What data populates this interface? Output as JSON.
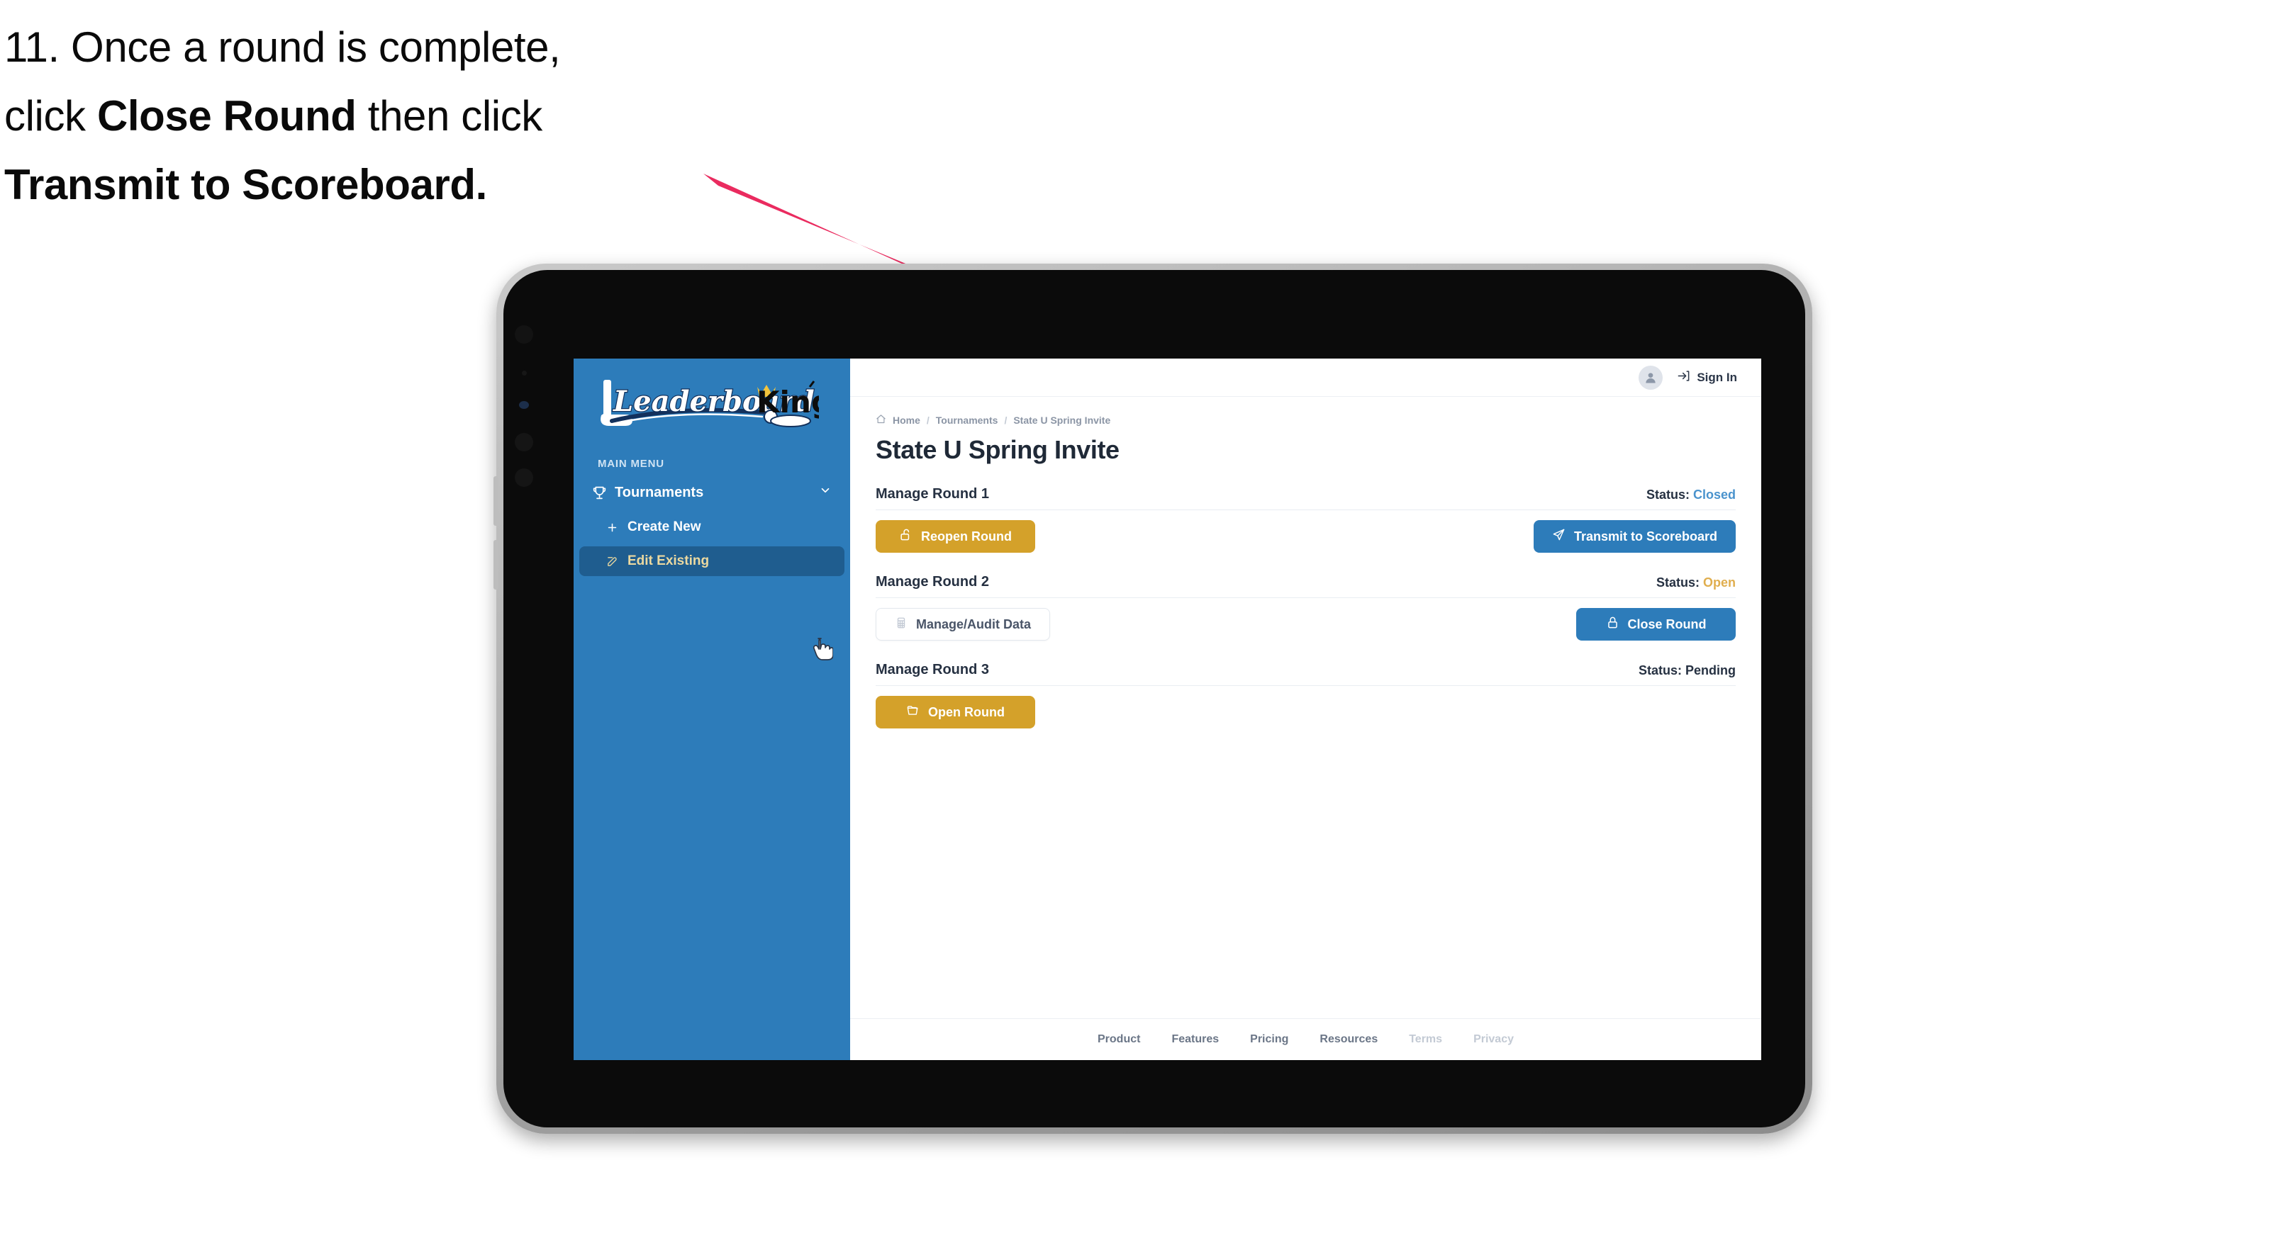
{
  "annotation": {
    "step_number": "11.",
    "line1_pre": "Once a round is complete,",
    "line2_pre": "click ",
    "line2_bold": "Close Round",
    "line2_post": " then click",
    "line3_bold": "Transmit to Scoreboard.",
    "arrow_color": "#ea2b5f"
  },
  "brand": {
    "logo_word_1": "Leaderboard",
    "logo_word_2": "King",
    "sidebar_color": "#2d7cba",
    "accent_gold": "#d4a12a",
    "accent_blue": "#2d7cba"
  },
  "sidebar": {
    "section_label": "MAIN MENU",
    "items": [
      {
        "label": "Tournaments",
        "icon": "trophy-icon",
        "expanded": true
      },
      {
        "label": "Create New",
        "icon": "plus-icon",
        "active": false
      },
      {
        "label": "Edit Existing",
        "icon": "pencil-square-icon",
        "active": true
      }
    ]
  },
  "topbar": {
    "avatar_icon": "user-avatar-icon",
    "signin_icon": "sign-in-arrow-icon",
    "signin_label": "Sign In"
  },
  "breadcrumb": {
    "home_icon": "home-icon",
    "items": [
      "Home",
      "Tournaments",
      "State U Spring Invite"
    ],
    "separator": "/"
  },
  "page": {
    "title": "State U Spring Invite"
  },
  "rounds": [
    {
      "name": "Manage Round 1",
      "status_label": "Status:",
      "status_value": "Closed",
      "status_kind": "closed",
      "left_button": {
        "label": "Reopen Round",
        "style": "gold",
        "icon": "unlock-icon"
      },
      "right_button": {
        "label": "Transmit to Scoreboard",
        "style": "blue",
        "icon": "paper-plane-icon"
      }
    },
    {
      "name": "Manage Round 2",
      "status_label": "Status:",
      "status_value": "Open",
      "status_kind": "open",
      "left_button": {
        "label": "Manage/Audit Data",
        "style": "ghost",
        "icon": "table-grid-icon"
      },
      "right_button": {
        "label": "Close Round",
        "style": "blue",
        "icon": "lock-icon"
      }
    },
    {
      "name": "Manage Round 3",
      "status_label": "Status:",
      "status_value": "Pending",
      "status_kind": "pending",
      "left_button": {
        "label": "Open Round",
        "style": "gold",
        "icon": "folder-open-icon"
      },
      "right_button": null
    }
  ],
  "footer": {
    "links": [
      {
        "label": "Product",
        "dim": false
      },
      {
        "label": "Features",
        "dim": false
      },
      {
        "label": "Pricing",
        "dim": false
      },
      {
        "label": "Resources",
        "dim": false
      },
      {
        "label": "Terms",
        "dim": true
      },
      {
        "label": "Privacy",
        "dim": true
      }
    ]
  }
}
